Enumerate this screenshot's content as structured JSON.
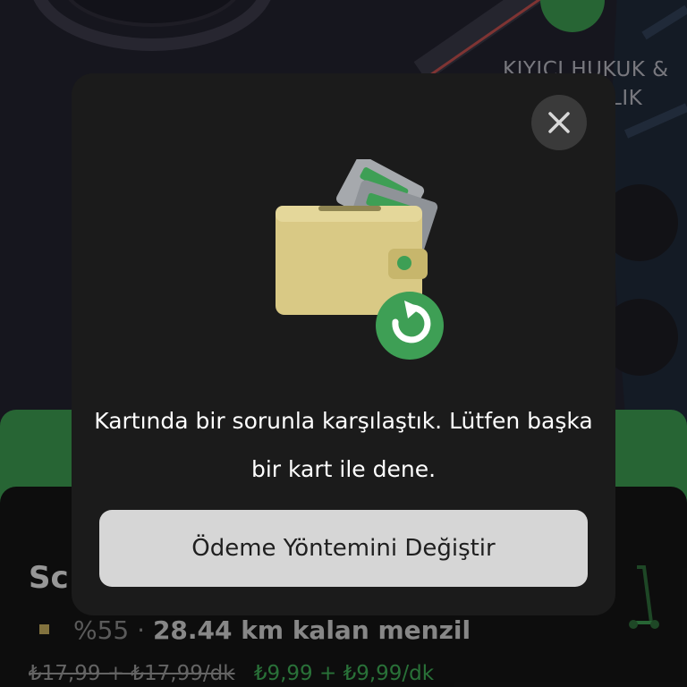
{
  "map": {
    "place_label_line1": "KIYICI HUKUK &",
    "place_label_line2": "LIK"
  },
  "bottom_sheet": {
    "title": "Sc",
    "battery_percent": "%55",
    "separator": "·",
    "range_text": "28.44 km kalan menzil",
    "old_price": "₺17,99 + ₺17,99/dk",
    "new_price": "₺9,99 + ₺9,99/dk"
  },
  "modal": {
    "message": "Kartında bir sorunla karşılaştık. Lütfen başka bir kart ile dene.",
    "primary_button_label": "Ödeme Yöntemini Değiştir",
    "close_icon": "close-icon",
    "illustration_icon": "wallet-refresh-icon"
  },
  "colors": {
    "accent_green": "#3d9c50",
    "modal_background": "#1b1b1b",
    "button_background": "#d6d6d6"
  }
}
